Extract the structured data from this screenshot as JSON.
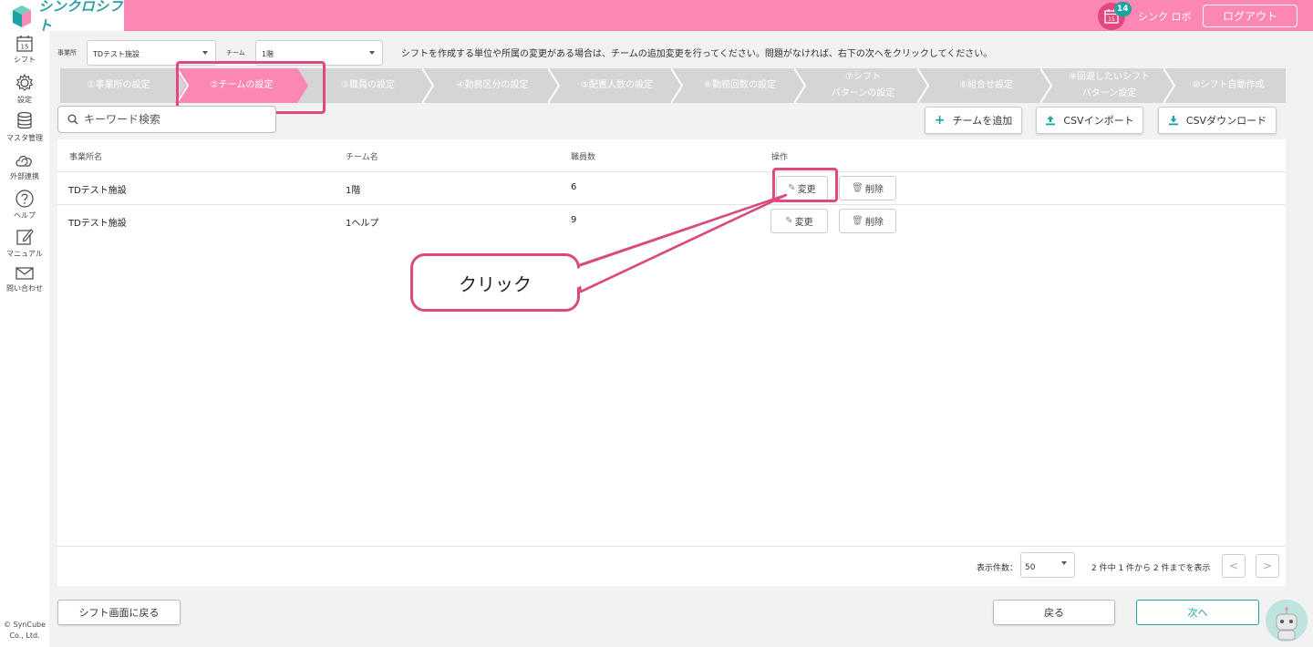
{
  "app": {
    "logo_text": "シンクロシフト",
    "notification_count": "14",
    "calendar_day": "15",
    "user_name": "シンク ロボ",
    "logout_label": "ログアウト"
  },
  "sidebar": {
    "items": [
      {
        "label": "シフト",
        "icon": "calendar-icon"
      },
      {
        "label": "設定",
        "icon": "gear-icon"
      },
      {
        "label": "マスタ管理",
        "icon": "database-icon"
      },
      {
        "label": "外部連携",
        "icon": "cloud-sync-icon"
      },
      {
        "label": "ヘルプ",
        "icon": "help-icon"
      },
      {
        "label": "マニュアル",
        "icon": "edit-icon"
      },
      {
        "label": "問い合わせ",
        "icon": "mail-icon"
      }
    ],
    "copyright": "© SynCube Co., Ltd."
  },
  "filters": {
    "office_label": "事業所",
    "office_value": "TDテスト施設",
    "team_label": "チーム",
    "team_value": "1階"
  },
  "instruction": "シフトを作成する単位や所属の変更がある場合は、チームの追加変更を行ってください。問題がなければ、右下の次へをクリックしてください。",
  "steps": [
    {
      "line1": "①事業所の設定",
      "line2": ""
    },
    {
      "line1": "②チームの設定",
      "line2": ""
    },
    {
      "line1": "③職員の設定",
      "line2": ""
    },
    {
      "line1": "④勤務区分の設定",
      "line2": ""
    },
    {
      "line1": "⑤配置人数の設定",
      "line2": ""
    },
    {
      "line1": "⑥勤務回数の設定",
      "line2": ""
    },
    {
      "line1": "⑦シフト",
      "line2": "パターンの設定"
    },
    {
      "line1": "⑧組合せ設定",
      "line2": ""
    },
    {
      "line1": "⑨回避したいシフト",
      "line2": "パターン設定"
    },
    {
      "line1": "⑩シフト自動作成",
      "line2": ""
    }
  ],
  "search": {
    "placeholder": "キーワード検索"
  },
  "actions": {
    "add_team": "チームを追加",
    "csv_import": "CSVインポート",
    "csv_download": "CSVダウンロード"
  },
  "table": {
    "headers": [
      "事業所名",
      "チーム名",
      "職員数",
      "操作"
    ],
    "rows": [
      {
        "office": "TDテスト施設",
        "team": "1階",
        "staff": "6"
      },
      {
        "office": "TDテスト施設",
        "team": "1ヘルプ",
        "staff": "9"
      }
    ],
    "edit_label": "変更",
    "delete_label": "削除"
  },
  "pagination": {
    "per_page_label": "表示件数：",
    "per_page_value": "50",
    "summary": "2 件中 1 件から 2 件までを表示",
    "prev": "<",
    "next": ">"
  },
  "footer": {
    "back_to_shift": "シフト画面に戻る",
    "back": "戻る",
    "next": "次へ"
  },
  "callout": {
    "text": "クリック"
  },
  "colors": {
    "header_pink": "#fc86b4",
    "accent_teal": "#1aa3a1",
    "highlight_red": "#e0487f",
    "step_gray": "#d5d5d5"
  }
}
